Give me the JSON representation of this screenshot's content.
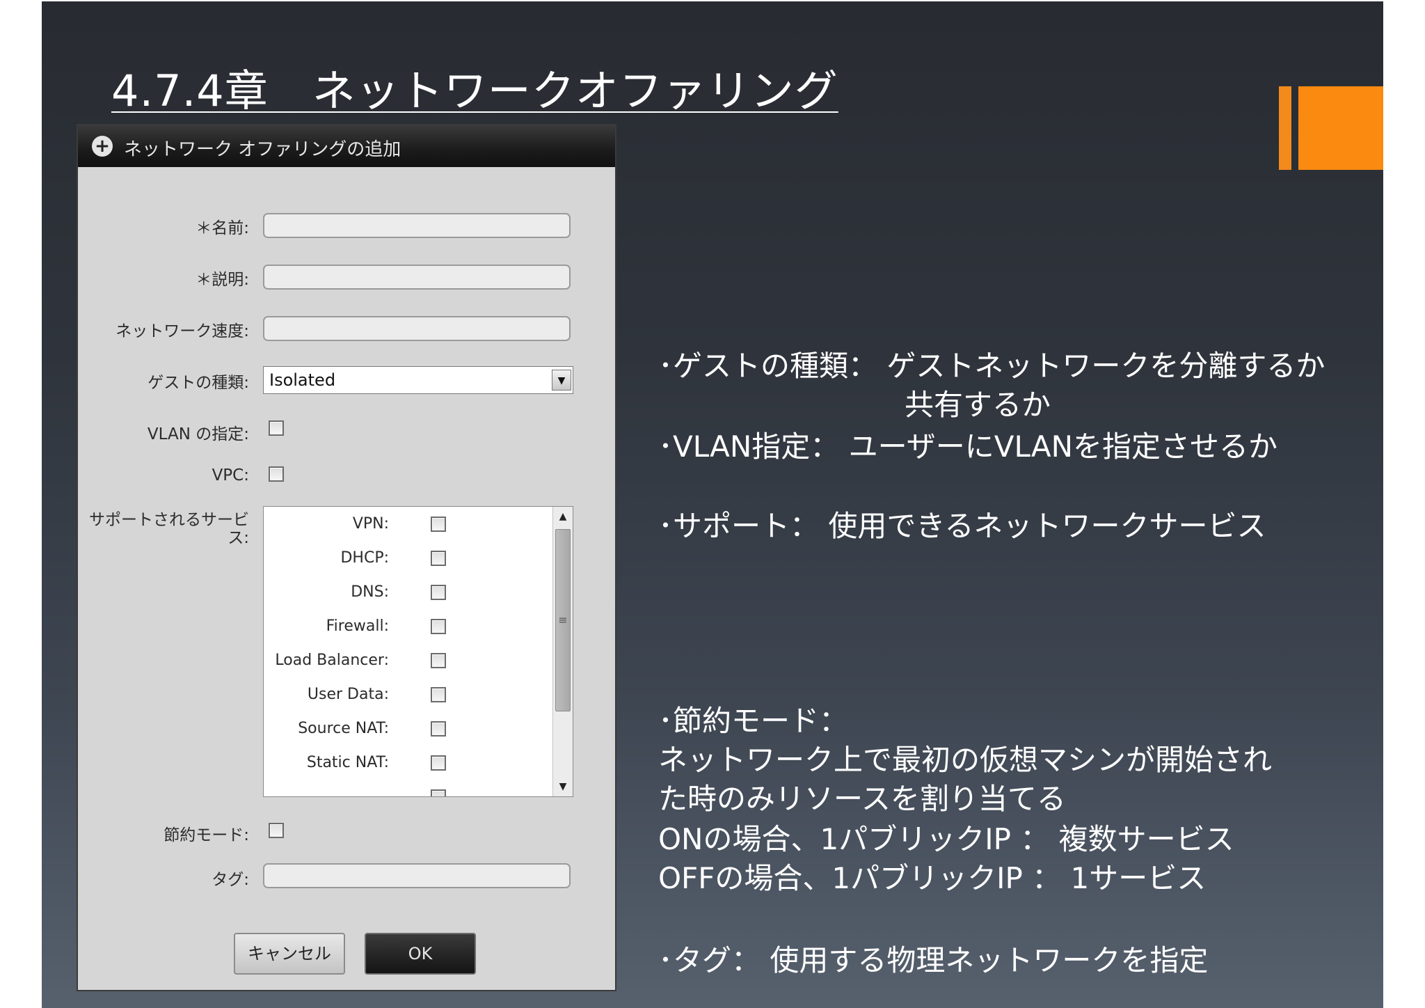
{
  "slide": {
    "title": "4.7.4章　ネットワークオファリング",
    "accent_color": "#fb8a10"
  },
  "dialog": {
    "icon": "plus-circle-icon",
    "title": "ネットワーク オファリングの追加",
    "fields": {
      "name_label": "＊名前:",
      "name_value": "",
      "description_label": "＊説明:",
      "description_value": "",
      "speed_label": "ネットワーク速度:",
      "speed_value": "",
      "guest_type_label": "ゲストの種類:",
      "guest_type_value": "Isolated",
      "vlan_label": "VLAN の指定:",
      "vpc_label": "VPC:",
      "services_label_line1": "サポートされるサービ",
      "services_label_line2": "ス:",
      "conserve_label": "節約モード:",
      "tag_label": "タグ:",
      "tag_value": ""
    },
    "services": [
      {
        "label": "VPN:",
        "checked": false
      },
      {
        "label": "DHCP:",
        "checked": false
      },
      {
        "label": "DNS:",
        "checked": false
      },
      {
        "label": "Firewall:",
        "checked": false
      },
      {
        "label": "Load Balancer:",
        "checked": false
      },
      {
        "label": "User Data:",
        "checked": false
      },
      {
        "label": "Source NAT:",
        "checked": false
      },
      {
        "label": "Static NAT:",
        "checked": false
      }
    ],
    "cancel_label": "キャンセル",
    "ok_label": "OK"
  },
  "notes": {
    "guest_type_line1": "･ゲストの種類：  ゲストネットワークを分離するか",
    "guest_type_line2": "共有するか",
    "vlan": "･VLAN指定：  ユーザーにVLANを指定させるか",
    "support": "･サポート：  使用できるネットワークサービス",
    "conserve_head": "･節約モード：",
    "conserve_line1": "  ネットワーク上で最初の仮想マシンが開始され",
    "conserve_line2": "た時のみリソースを割り当てる",
    "conserve_on": "  ONの場合、1パブリックIP ： 複数サービス",
    "conserve_off": "  OFFの場合、1パブリックIP ： 1サービス",
    "tag": "･タグ：  使用する物理ネットワークを指定"
  }
}
